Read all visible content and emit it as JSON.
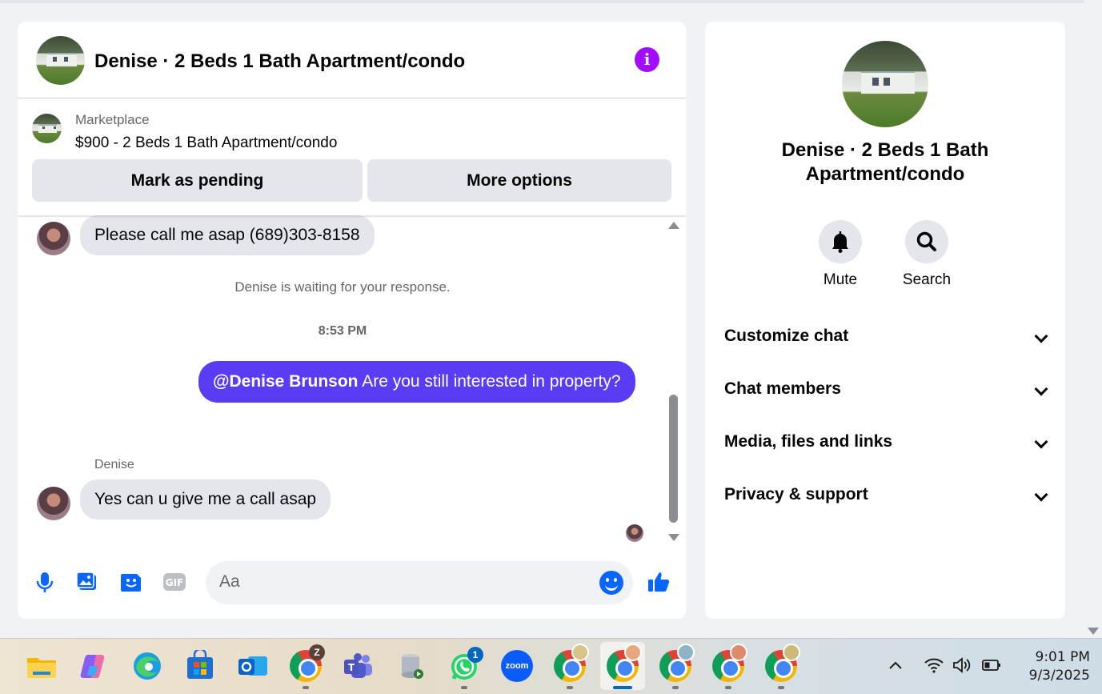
{
  "chat": {
    "title": "Denise · 2 Beds 1 Bath Apartment/condo",
    "marketplace_label": "Marketplace",
    "listing": "$900 - 2 Beds 1 Bath Apartment/condo",
    "mark_pending_label": "Mark as pending",
    "more_options_label": "More options",
    "messages": [
      {
        "from": "Denise",
        "text": "Please call me asap (689)303-8158"
      },
      {
        "system": "Denise is waiting for your response."
      },
      {
        "time": "8:53 PM"
      },
      {
        "from": "me",
        "mention": "@Denise Brunson",
        "text": " Are you still interested in property?"
      },
      {
        "sender_label": "Denise",
        "from": "Denise",
        "text": "Yes can u give me a call asap"
      }
    ],
    "composer_placeholder": "Aa"
  },
  "info_panel": {
    "title": "Denise · 2 Beds 1 Bath Apartment/condo",
    "mute_label": "Mute",
    "search_label": "Search",
    "sections": [
      "Customize chat",
      "Chat members",
      "Media, files and links",
      "Privacy & support"
    ]
  },
  "taskbar": {
    "time": "9:01 PM",
    "date": "9/3/2025",
    "chrome_badge": "Z",
    "whatsapp_badge": "1",
    "zoom_label": "zoom"
  },
  "colors": {
    "accent_purple": "#a20cff",
    "bubble_out": "#5b3cf5",
    "messenger_blue": "#0866ff"
  }
}
